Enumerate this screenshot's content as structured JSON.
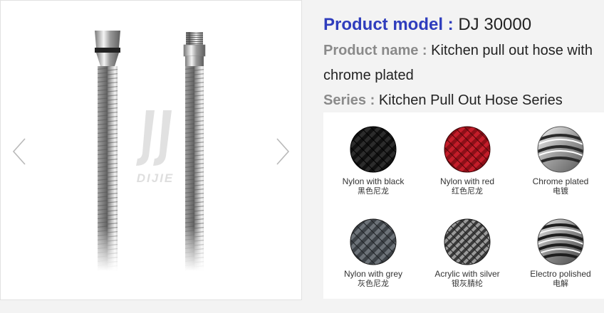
{
  "gallery": {
    "prev_icon": "chevron-left-icon",
    "next_icon": "chevron-right-icon",
    "watermark_text": "DIJIE"
  },
  "product": {
    "model_label": "Product model :",
    "model_value": "DJ 30000",
    "name_label": "Product name :",
    "name_value_1": "Kitchen pull out hose with",
    "name_value_2": "chrome plated",
    "series_label": "Series :",
    "series_value": "Kitchen Pull Out Hose Series"
  },
  "swatches": [
    {
      "en": "Nylon with black",
      "cn": "黑色尼龙",
      "color": "#111111"
    },
    {
      "en": "Nylon with red",
      "cn": "红色尼龙",
      "color": "#a8141e"
    },
    {
      "en": "Chrome plated",
      "cn": "电镀",
      "color": "#c8c8c8"
    },
    {
      "en": "Nylon with grey",
      "cn": "灰色尼龙",
      "color": "#4a4f55"
    },
    {
      "en": "Acrylic with silver",
      "cn": "银灰腈纶",
      "color": "#5a5a5a"
    },
    {
      "en": "Electro polished",
      "cn": "电解",
      "color": "#b5b5b5"
    }
  ]
}
